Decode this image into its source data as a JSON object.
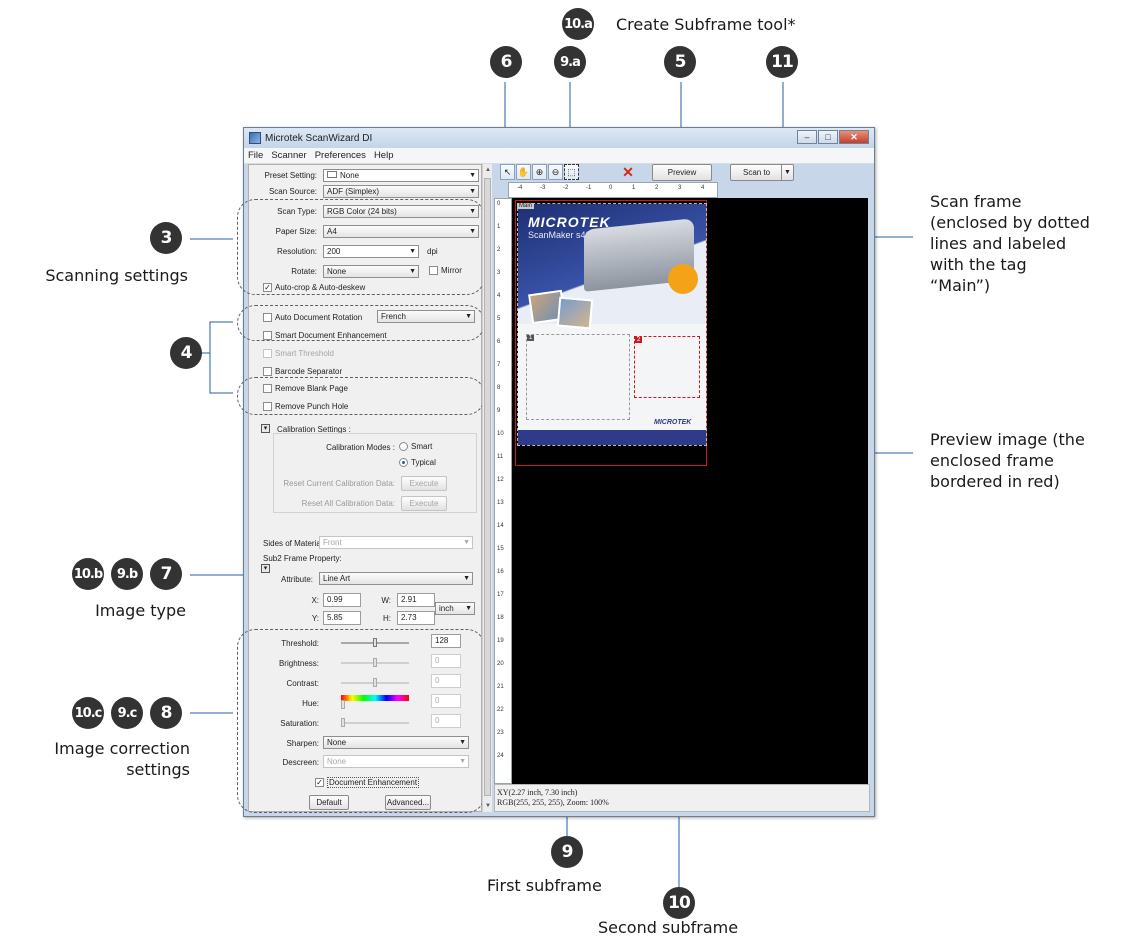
{
  "window": {
    "title": "Microtek ScanWizard DI",
    "buttons": {
      "minimize": "–",
      "maximize": "□",
      "close": "✕"
    }
  },
  "menu": [
    "File",
    "Scanner",
    "Preferences",
    "Help"
  ],
  "settings": {
    "preset_label": "Preset Setting:",
    "preset_value": "None",
    "source_label": "Scan Source:",
    "source_value": "ADF (Simplex)",
    "type_label": "Scan Type:",
    "type_value": "RGB Color (24 bits)",
    "paper_label": "Paper Size:",
    "paper_value": "A4",
    "resolution_label": "Resolution:",
    "resolution_value": "200",
    "resolution_unit": "dpi",
    "rotate_label": "Rotate:",
    "rotate_value": "None",
    "mirror_label": "Mirror",
    "autocrop_label": "Auto-crop & Auto-deskew",
    "auto_rotation_label": "Auto Document Rotation",
    "language_value": "French",
    "smart_enhancement_label": "Smart Document Enhancement",
    "smart_threshold_label": "Smart Threshold",
    "barcode_label": "Barcode Separator",
    "blank_page_label": "Remove Blank Page",
    "punch_hole_label": "Remove Punch Hole",
    "calibration_label": "Calibration Settings :",
    "calibration_modes_label": "Calibration Modes :",
    "mode_smart": "Smart",
    "mode_typical": "Typical",
    "reset_current_label": "Reset Current Calibration Data:",
    "reset_all_label": "Reset All Calibration Data:",
    "execute_label": "Execute",
    "sides_label": "Sides of Material:",
    "sides_value": "Front",
    "subframe_property_label": "Sub2 Frame Property:",
    "attribute_label": "Attribute:",
    "attribute_value": "Line Art",
    "x_label": "X:",
    "x_value": "0.99",
    "w_label": "W:",
    "w_value": "2.91",
    "y_label": "Y:",
    "y_value": "5.85",
    "h_label": "H:",
    "h_value": "2.73",
    "unit_value": "inch"
  },
  "correction": {
    "threshold_label": "Threshold:",
    "threshold_value": "128",
    "brightness_label": "Brightness:",
    "brightness_value": "0",
    "contrast_label": "Contrast:",
    "contrast_value": "0",
    "hue_label": "Hue:",
    "hue_value": "0",
    "saturation_label": "Saturation:",
    "saturation_value": "0",
    "sharpen_label": "Sharpen:",
    "sharpen_value": "None",
    "descreen_label": "Descreen:",
    "descreen_value": "None",
    "doc_enhancement_label": "Document Enhancement",
    "default_button": "Default",
    "advanced_button": "Advanced..."
  },
  "toolbar": {
    "preview_button": "Preview",
    "scan_button": "Scan to"
  },
  "ruler": {
    "top": [
      "-4",
      "-3",
      "-2",
      "-1",
      "0",
      "1",
      "2",
      "3",
      "4"
    ],
    "left": [
      "0",
      "1",
      "2",
      "3",
      "4",
      "5",
      "6",
      "7",
      "8",
      "9",
      "10",
      "11",
      "12",
      "13",
      "14",
      "15",
      "16",
      "17",
      "18",
      "19",
      "20",
      "21",
      "22",
      "23",
      "24"
    ]
  },
  "preview": {
    "main_tag": "Main",
    "brand": "MICROTEK",
    "product": "ScanMaker s400",
    "footer_logo": "MICROTEK",
    "subframe_tag_1": "1",
    "subframe_tag_2": "2"
  },
  "status": {
    "line1": "XY(2.27 inch, 7.30 inch)",
    "line2": "RGB(255, 255, 255), Zoom: 100%"
  },
  "callouts": {
    "b3": "3",
    "b4": "4",
    "b5": "5",
    "b6": "6",
    "b7": "7",
    "b8": "8",
    "b9": "9",
    "b9a": "9.a",
    "b9b": "9.b",
    "b9c": "9.c",
    "b10": "10",
    "b10a": "10.a",
    "b10b": "10.b",
    "b10c": "10.c",
    "b11": "11",
    "create_subframe": "Create Subframe tool*",
    "scanning_settings": "Scanning settings",
    "scan_frame": [
      "Scan frame",
      "(enclosed by dotted",
      "lines and labeled",
      "with the tag",
      "“Main”)"
    ],
    "preview_image": [
      "Preview image (the",
      "enclosed frame",
      "bordered in red)"
    ],
    "image_type": "Image type",
    "image_correction": [
      "Image correction",
      "settings"
    ],
    "first_subframe": "First subframe",
    "second_subframe": "Second subframe"
  },
  "colors": {
    "annotation_line": "#1f5fa8",
    "badge": "#333333",
    "frame_red": "#d2171a"
  }
}
